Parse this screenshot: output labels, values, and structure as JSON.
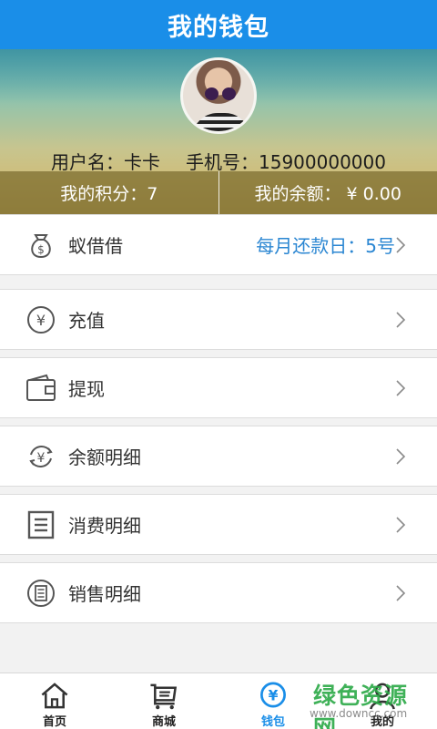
{
  "header": {
    "title": "我的钱包"
  },
  "profile": {
    "username_label": "用户名：",
    "username": "卡卡",
    "phone_label": "手机号：",
    "phone": "15900000000",
    "points_text": "我的积分：7",
    "balance_text": "我的余额： ¥ 0.00"
  },
  "menu": [
    {
      "label": "蚁借借",
      "extra": "每月还款日：5号",
      "icon": "money-bag-icon"
    },
    {
      "label": "充值",
      "extra": "",
      "icon": "yuan-circle-icon"
    },
    {
      "label": "提现",
      "extra": "",
      "icon": "wallet-icon"
    },
    {
      "label": "余额明细",
      "extra": "",
      "icon": "yuan-refresh-icon"
    },
    {
      "label": "消费明细",
      "extra": "",
      "icon": "list-document-icon"
    },
    {
      "label": "销售明细",
      "extra": "",
      "icon": "receipt-circle-icon"
    }
  ],
  "tabs": [
    {
      "label": "首页",
      "icon": "home-icon",
      "active": false
    },
    {
      "label": "商城",
      "icon": "cart-icon",
      "active": false
    },
    {
      "label": "钱包",
      "icon": "wallet-yuan-icon",
      "active": true
    },
    {
      "label": "我的",
      "icon": "person-icon",
      "active": false
    }
  ],
  "watermark": {
    "line1": "绿色资源网",
    "line2": "www.downcc.com"
  },
  "colors": {
    "primary": "#1a8ee8",
    "accent_text": "#2a86d2",
    "background": "#f2f2f2"
  }
}
